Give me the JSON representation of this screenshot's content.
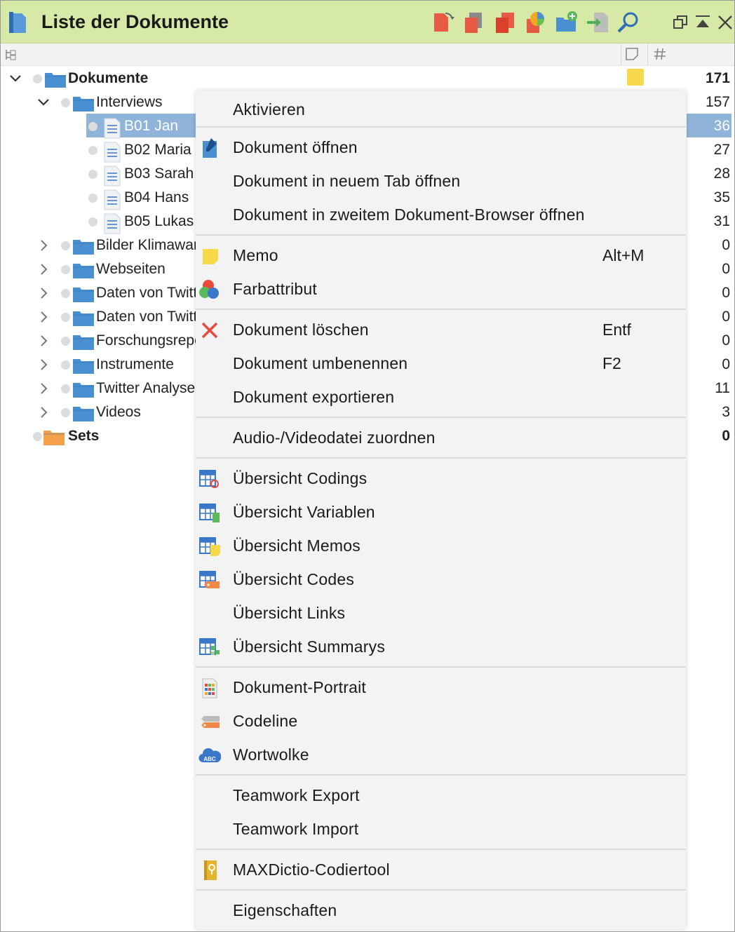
{
  "window": {
    "title": "Liste der Dokumente",
    "colors": {
      "titlebar": "#d7e9a6",
      "selection": "#8fb3d9",
      "folder": "#4a8fd0",
      "set_folder": "#f5a04a"
    },
    "toolbar_icons": [
      "activate-documents-icon",
      "copy-documents-icon",
      "red-docs-icon",
      "color-docs-icon",
      "new-folder-icon",
      "import-icon",
      "search-icon"
    ],
    "window_icons": [
      "undock-icon",
      "collapse-icon",
      "close-icon"
    ]
  },
  "tree": [
    {
      "name": "root",
      "label": "Dokumente",
      "count": "171",
      "expanded": true,
      "bold": true,
      "type": "folder"
    },
    {
      "name": "interviews",
      "label": "Interviews",
      "count": "157",
      "expanded": true,
      "type": "folder"
    },
    {
      "name": "b01",
      "label": "B01 Jan",
      "count": "36",
      "type": "doc",
      "selected": true
    },
    {
      "name": "b02",
      "label": "B02 Maria",
      "count": "27",
      "type": "doc"
    },
    {
      "name": "b03",
      "label": "B03 Sarah",
      "count": "28",
      "type": "doc"
    },
    {
      "name": "b04",
      "label": "B04 Hans",
      "count": "35",
      "type": "doc"
    },
    {
      "name": "b05",
      "label": "B05 Lukas",
      "count": "31",
      "type": "doc"
    },
    {
      "name": "bilder",
      "label": "Bilder Klimawar",
      "count": "0",
      "type": "folder"
    },
    {
      "name": "webseiten",
      "label": "Webseiten",
      "count": "0",
      "type": "folder"
    },
    {
      "name": "twitter1",
      "label": "Daten von Twitt",
      "count": "0",
      "type": "folder"
    },
    {
      "name": "twitter2",
      "label": "Daten von Twitt",
      "count": "0",
      "type": "folder"
    },
    {
      "name": "forschung",
      "label": "Forschungsrepo",
      "count": "0",
      "type": "folder"
    },
    {
      "name": "instrumente",
      "label": "Instrumente",
      "count": "0",
      "type": "folder"
    },
    {
      "name": "twitteranalyse",
      "label": "Twitter Analyse",
      "count": "11",
      "type": "folder"
    },
    {
      "name": "videos",
      "label": "Videos",
      "count": "3",
      "type": "folder"
    },
    {
      "name": "sets",
      "label": "Sets",
      "count": "0",
      "type": "sets",
      "bold": true
    }
  ],
  "menu": {
    "aktivieren": "Aktivieren",
    "oeffnen": "Dokument öffnen",
    "neuer_tab": "Dokument in neuem Tab öffnen",
    "zweiter_browser": "Dokument in zweitem Dokument-Browser öffnen",
    "memo": "Memo",
    "memo_shortcut": "Alt+M",
    "farbattribut": "Farbattribut",
    "loeschen": "Dokument löschen",
    "loeschen_shortcut": "Entf",
    "umbenennen": "Dokument umbenennen",
    "umbenennen_shortcut": "F2",
    "exportieren": "Dokument exportieren",
    "audio_video": "Audio-/Videodatei zuordnen",
    "uebersicht_codings": "Übersicht Codings",
    "uebersicht_variablen": "Übersicht Variablen",
    "uebersicht_memos": "Übersicht Memos",
    "uebersicht_codes": "Übersicht Codes",
    "uebersicht_links": "Übersicht Links",
    "uebersicht_summarys": "Übersicht Summarys",
    "portrait": "Dokument-Portrait",
    "codeline": "Codeline",
    "wortwolke": "Wortwolke",
    "teamwork_export": "Teamwork Export",
    "teamwork_import": "Teamwork Import",
    "maxdictio": "MAXDictio-Codiertool",
    "eigenschaften": "Eigenschaften"
  }
}
